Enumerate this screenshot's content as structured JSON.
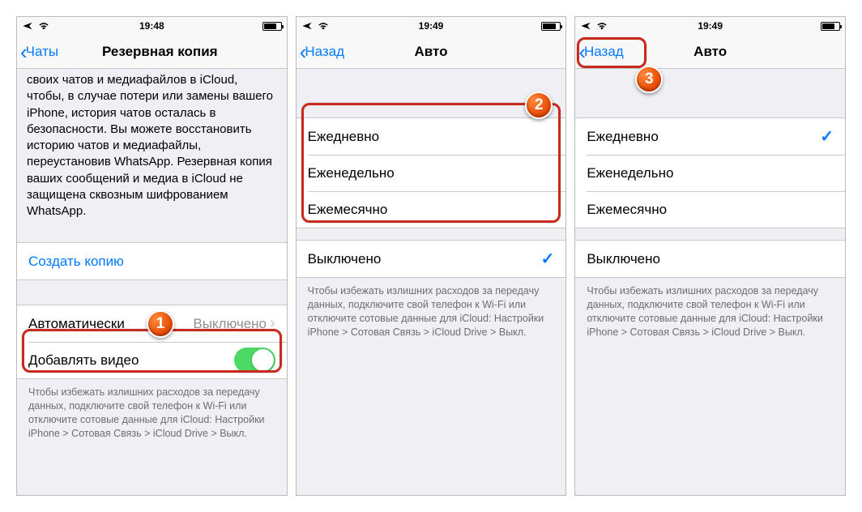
{
  "screens": [
    {
      "status": {
        "time": "19:48"
      },
      "nav": {
        "back": "Чаты",
        "title": "Резервная копия"
      },
      "info": "своих чатов и медиафайлов в iCloud, чтобы, в случае потери или замены вашего iPhone, история чатов осталась в безопасности. Вы можете восстановить историю чатов и медиафайлы, переустановив WhatsApp. Резервная копия ваших сообщений и медиа в iCloud не защищена сквозным шифрованием WhatsApp.",
      "create_link": "Создать копию",
      "auto": {
        "label": "Автоматически",
        "value": "Выключено"
      },
      "video_label": "Добавлять видео",
      "footer": "Чтобы избежать излишних расходов за передачу данных, подключите свой телефон к Wi-Fi или отключите сотовые данные для iCloud: Настройки iPhone > Сотовая Связь > iCloud Drive > Выкл.",
      "badge": "1"
    },
    {
      "status": {
        "time": "19:49"
      },
      "nav": {
        "back": "Назад",
        "title": "Авто"
      },
      "options": [
        {
          "label": "Ежедневно",
          "checked": false
        },
        {
          "label": "Еженедельно",
          "checked": false
        },
        {
          "label": "Ежемесячно",
          "checked": false
        }
      ],
      "off_option": {
        "label": "Выключено",
        "checked": true
      },
      "footer": "Чтобы избежать излишних расходов за передачу данных, подключите свой телефон к Wi-Fi или отключите сотовые данные для iCloud: Настройки iPhone > Сотовая Связь > iCloud Drive > Выкл.",
      "badge": "2"
    },
    {
      "status": {
        "time": "19:49"
      },
      "nav": {
        "back": "Назад",
        "title": "Авто"
      },
      "options": [
        {
          "label": "Ежедневно",
          "checked": true
        },
        {
          "label": "Еженедельно",
          "checked": false
        },
        {
          "label": "Ежемесячно",
          "checked": false
        }
      ],
      "off_option": {
        "label": "Выключено",
        "checked": false
      },
      "footer": "Чтобы избежать излишних расходов за передачу данных, подключите свой телефон к Wi-Fi или отключите сотовые данные для iCloud: Настройки iPhone > Сотовая Связь > iCloud Drive > Выкл.",
      "badge": "3"
    }
  ]
}
